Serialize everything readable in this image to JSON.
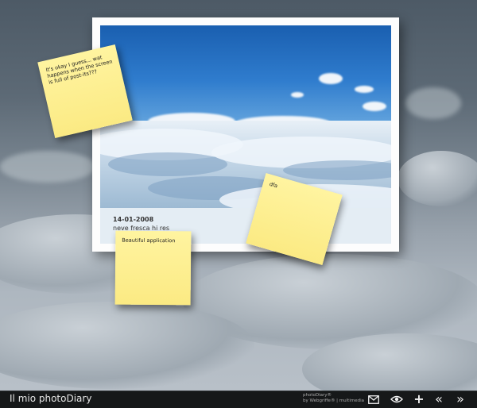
{
  "photo": {
    "date": "14-01-2008",
    "title": "neve fresca hi res"
  },
  "notes": [
    {
      "text": "It's okay I guess... wat happens when the screen is full of post-its???"
    },
    {
      "text": "Beautiful application"
    },
    {
      "text": "dfa"
    }
  ],
  "app": {
    "title": "Il mio photoDiary",
    "credit_line1": "photoDiary®",
    "credit_line2": "by Webgriffe® | multimedia"
  },
  "toolbar": {
    "mail_icon": "mail-icon",
    "view_icon": "eye-icon",
    "add_label": "+",
    "prev_label": "«",
    "next_label": "»"
  }
}
